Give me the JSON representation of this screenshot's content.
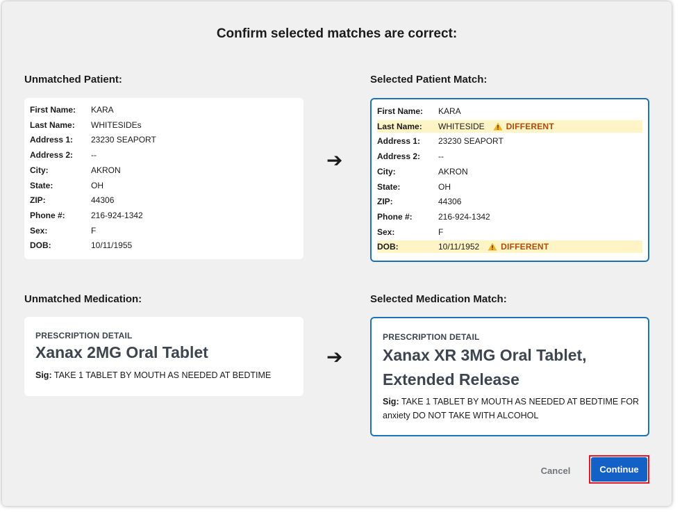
{
  "modal": {
    "title": "Confirm selected matches are correct:"
  },
  "unmatched_patient": {
    "label": "Unmatched Patient:",
    "fields": [
      {
        "label": "First Name:",
        "value": "KARA"
      },
      {
        "label": "Last Name:",
        "value": "WHITESIDEs"
      },
      {
        "label": "Address 1:",
        "value": "23230 SEAPORT"
      },
      {
        "label": "Address 2:",
        "value": "--"
      },
      {
        "label": "City:",
        "value": "AKRON"
      },
      {
        "label": "State:",
        "value": "OH"
      },
      {
        "label": "ZIP:",
        "value": "44306"
      },
      {
        "label": "Phone #:",
        "value": "216-924-1342"
      },
      {
        "label": "Sex:",
        "value": "F"
      },
      {
        "label": "DOB:",
        "value": "10/11/1955"
      }
    ]
  },
  "selected_patient": {
    "label": "Selected Patient Match:",
    "fields": [
      {
        "label": "First Name:",
        "value": "KARA"
      },
      {
        "label": "Last Name:",
        "value": "WHITESIDE",
        "flag": "DIFFERENT"
      },
      {
        "label": "Address 1:",
        "value": "23230 SEAPORT"
      },
      {
        "label": "Address 2:",
        "value": "--"
      },
      {
        "label": "City:",
        "value": "AKRON"
      },
      {
        "label": "State:",
        "value": "OH"
      },
      {
        "label": "ZIP:",
        "value": "44306"
      },
      {
        "label": "Phone #:",
        "value": "216-924-1342"
      },
      {
        "label": "Sex:",
        "value": "F"
      },
      {
        "label": "DOB:",
        "value": "10/11/1952",
        "flag": "DIFFERENT"
      }
    ]
  },
  "arrow_glyph": "➔",
  "unmatched_medication": {
    "label": "Unmatched Medication:",
    "eyebrow": "PRESCRIPTION DETAIL",
    "name": "Xanax 2MG Oral Tablet",
    "sig_label": "Sig:",
    "sig_text": "TAKE 1 TABLET BY MOUTH AS NEEDED AT BEDTIME"
  },
  "selected_medication": {
    "label": "Selected Medication Match:",
    "eyebrow": "PRESCRIPTION DETAIL",
    "name_line1": "Xanax XR 3MG Oral Tablet,",
    "name_line2": "Extended Release",
    "sig_label": "Sig:",
    "sig_line1": "TAKE 1 TABLET BY MOUTH AS NEEDED AT BEDTIME FOR",
    "sig_line2": "anxiety DO NOT TAKE WITH ALCOHOL"
  },
  "actions": {
    "cancel_label": "Cancel",
    "continue_label": "Continue"
  },
  "colors": {
    "accent_blue": "#1a72b8",
    "primary_button": "#1360c7",
    "diff_highlight": "#fff4c6",
    "diff_text": "#b34a0a",
    "focus_outline": "#e0192a"
  },
  "icons": {
    "diff_flag": "warning-icon"
  }
}
